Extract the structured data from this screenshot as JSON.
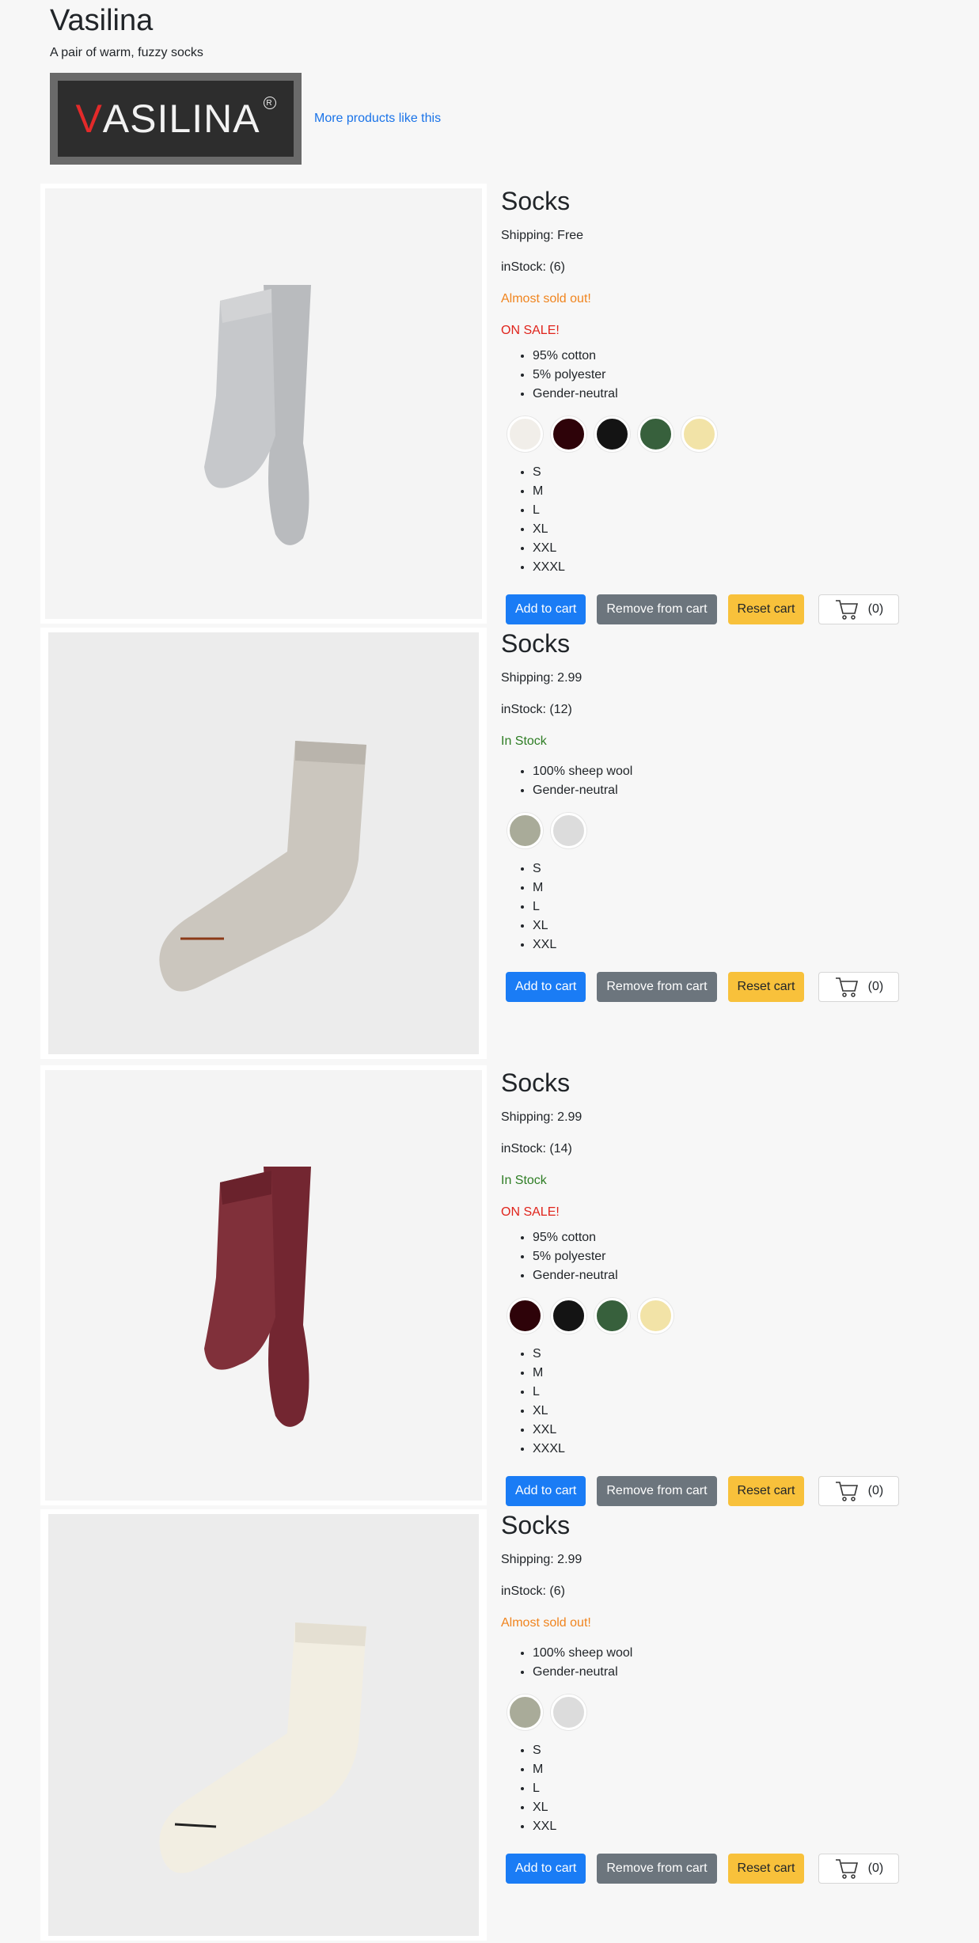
{
  "header": {
    "title": "Vasilina",
    "tagline": "A pair of warm, fuzzy socks",
    "logo_text_v": "V",
    "logo_text_rest": "ASILINA",
    "logo_reg": "R",
    "more_link": "More products like this"
  },
  "buttons": {
    "add": "Add to cart",
    "remove": "Remove from cart",
    "reset": "Reset cart"
  },
  "cart": {
    "count": "(0)"
  },
  "products": [
    {
      "name": "Socks",
      "shipping": "Shipping: Free",
      "in_stock": "inStock: (6)",
      "status": "Almost sold out!",
      "sale": "ON SALE!",
      "details": [
        "95% cotton",
        "5% polyester",
        "Gender-neutral"
      ],
      "colors": [
        "#f1eee9",
        "#2e0309",
        "#141414",
        "#37603c",
        "#f2e3a7"
      ],
      "sizes": [
        "S",
        "M",
        "L",
        "XL",
        "XXL",
        "XXXL"
      ],
      "sock_color": "#c2c4c7"
    },
    {
      "name": "Socks",
      "shipping": "Shipping: 2.99",
      "in_stock": "inStock: (12)",
      "status": "In Stock",
      "details": [
        "100% sheep wool",
        "Gender-neutral"
      ],
      "colors": [
        "#a9ab99",
        "#dcdcdc"
      ],
      "sizes": [
        "S",
        "M",
        "L",
        "XL",
        "XXL"
      ],
      "sock_color": "#cfcac2"
    },
    {
      "name": "Socks",
      "shipping": "Shipping: 2.99",
      "in_stock": "inStock: (14)",
      "status": "In Stock",
      "sale": "ON SALE!",
      "details": [
        "95% cotton",
        "5% polyester",
        "Gender-neutral"
      ],
      "colors": [
        "#2e0309",
        "#141414",
        "#37603c",
        "#f2e3a7"
      ],
      "sizes": [
        "S",
        "M",
        "L",
        "XL",
        "XXL",
        "XXXL"
      ],
      "sock_color": "#7d2a33"
    },
    {
      "name": "Socks",
      "shipping": "Shipping: 2.99",
      "in_stock": "inStock: (6)",
      "status": "Almost sold out!",
      "details": [
        "100% sheep wool",
        "Gender-neutral"
      ],
      "colors": [
        "#a9ab99",
        "#dcdcdc"
      ],
      "sizes": [
        "S",
        "M",
        "L",
        "XL",
        "XXL"
      ],
      "sock_color": "#f1ece0"
    }
  ]
}
